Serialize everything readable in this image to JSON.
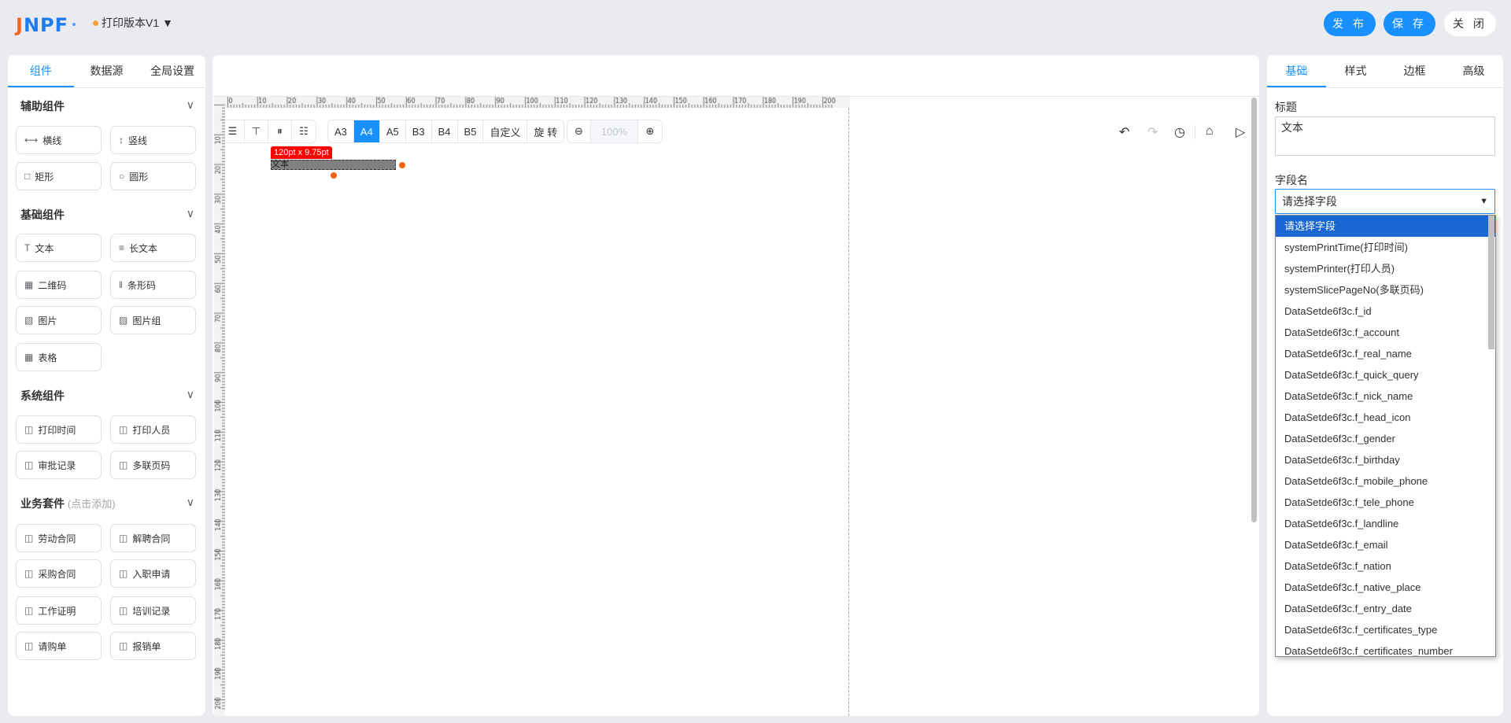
{
  "header": {
    "logo": "JNPF",
    "version": "打印版本V1",
    "publish": "发 布",
    "save": "保 存",
    "close": "关 闭"
  },
  "left": {
    "tabs": [
      "组件",
      "数据源",
      "全局设置"
    ],
    "sections": [
      {
        "title": "辅助组件",
        "note": "",
        "items": [
          {
            "label": "横线",
            "icon": "horizontal-line-icon"
          },
          {
            "label": "竖线",
            "icon": "vertical-line-icon"
          },
          {
            "label": "矩形",
            "icon": "rectangle-icon"
          },
          {
            "label": "圆形",
            "icon": "circle-icon"
          }
        ]
      },
      {
        "title": "基础组件",
        "note": "",
        "items": [
          {
            "label": "文本",
            "icon": "text-icon"
          },
          {
            "label": "长文本",
            "icon": "long-text-icon"
          },
          {
            "label": "二维码",
            "icon": "qrcode-icon"
          },
          {
            "label": "条形码",
            "icon": "barcode-icon"
          },
          {
            "label": "图片",
            "icon": "image-icon"
          },
          {
            "label": "图片组",
            "icon": "image-group-icon"
          },
          {
            "label": "表格",
            "icon": "table-icon"
          }
        ]
      },
      {
        "title": "系统组件",
        "note": "",
        "items": [
          {
            "label": "打印时间",
            "icon": "template-icon"
          },
          {
            "label": "打印人员",
            "icon": "template-icon"
          },
          {
            "label": "审批记录",
            "icon": "template-icon"
          },
          {
            "label": "多联页码",
            "icon": "template-icon"
          }
        ]
      },
      {
        "title": "业务套件",
        "note": "(点击添加)",
        "items": [
          {
            "label": "劳动合同",
            "icon": "template-icon"
          },
          {
            "label": "解聘合同",
            "icon": "template-icon"
          },
          {
            "label": "采购合同",
            "icon": "template-icon"
          },
          {
            "label": "入职申请",
            "icon": "template-icon"
          },
          {
            "label": "工作证明",
            "icon": "template-icon"
          },
          {
            "label": "培训记录",
            "icon": "template-icon"
          },
          {
            "label": "请购单",
            "icon": "template-icon"
          },
          {
            "label": "报销单",
            "icon": "template-icon"
          }
        ]
      }
    ]
  },
  "toolbar": {
    "paper": [
      "A3",
      "A4",
      "A5",
      "B3",
      "B4",
      "B5",
      "自定义",
      "旋 转"
    ],
    "active_paper": "A4",
    "zoom": "100%"
  },
  "ruler": {
    "step": 10,
    "max": 200
  },
  "canvas": {
    "element_text": "文本",
    "size_label": "120pt x 9.75pt"
  },
  "right": {
    "tabs": [
      "基础",
      "样式",
      "边框",
      "高级"
    ],
    "title_label": "标题",
    "title_value": "文本",
    "field_label": "字段名",
    "field_placeholder": "请选择字段",
    "options": [
      "请选择字段",
      "systemPrintTime(打印时间)",
      "systemPrinter(打印人员)",
      "systemSlicePageNo(多联页码)",
      "DataSetde6f3c.f_id",
      "DataSetde6f3c.f_account",
      "DataSetde6f3c.f_real_name",
      "DataSetde6f3c.f_quick_query",
      "DataSetde6f3c.f_nick_name",
      "DataSetde6f3c.f_head_icon",
      "DataSetde6f3c.f_gender",
      "DataSetde6f3c.f_birthday",
      "DataSetde6f3c.f_mobile_phone",
      "DataSetde6f3c.f_tele_phone",
      "DataSetde6f3c.f_landline",
      "DataSetde6f3c.f_email",
      "DataSetde6f3c.f_nation",
      "DataSetde6f3c.f_native_place",
      "DataSetde6f3c.f_entry_date",
      "DataSetde6f3c.f_certificates_type",
      "DataSetde6f3c.f_certificates_number"
    ]
  },
  "colors": {
    "primary": "#1890ff",
    "label_red": "#ff0000",
    "handle": "#f5620f"
  }
}
